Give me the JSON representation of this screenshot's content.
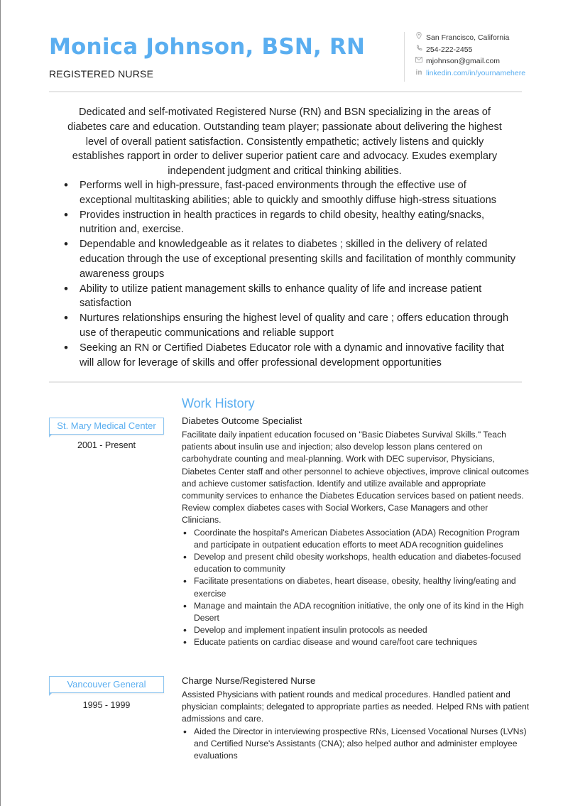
{
  "header": {
    "name": "Monica Johnson, BSN, RN",
    "title": "REGISTERED NURSE"
  },
  "contact": {
    "location": {
      "icon": "map-pin-icon",
      "text": "San Francisco, California"
    },
    "phone": {
      "icon": "phone-icon",
      "text": "254-222-2455"
    },
    "email": {
      "icon": "envelope-icon",
      "text": "mjohnson@gmail.com"
    },
    "linkedin": {
      "icon": "linkedin-icon",
      "glyph": "in",
      "text": "linkedin.com/in/yournamehere"
    }
  },
  "summary": {
    "paragraph": "Dedicated and self-motivated Registered Nurse (RN) and BSN  specializing in the areas of diabetes care and education. Outstanding team player; passionate about delivering the highest level of overall patient satisfaction. Consistently empathetic; actively listens and quickly establishes rapport in order to deliver superior patient care and advocacy. Exudes exemplary independent judgment and critical thinking abilities.",
    "bullets": [
      "Performs well in high-pressure, fast-paced environments through the effective use of exceptional multitasking abilities; able to quickly and smoothly diffuse high-stress situations",
      "Provides instruction in health practices in regards to child obesity, healthy eating/snacks, nutrition and, exercise.",
      "Dependable and knowledgeable as it relates to diabetes ; skilled in the delivery of related education through the use of exceptional presenting skills and facilitation of monthly community awareness groups",
      "Ability to utilize patient management skills to enhance quality of life  and increase patient satisfaction",
      "Nurtures relationships ensuring the highest level of quality and care ; offers education through use of therapeutic communications and reliable support",
      "Seeking an RN or Certified Diabetes Educator  role with a dynamic and innovative facility that will allow for leverage of skills and offer professional development opportunities"
    ]
  },
  "work_history": {
    "title": "Work History",
    "jobs": [
      {
        "company": "St. Mary Medical Center",
        "dates": "2001 - Present",
        "role": "Diabetes Outcome Specialist",
        "description": "Facilitate daily inpatient education focused on \"Basic Diabetes Survival Skills.\" Teach patients about insulin use and injection; also develop lesson plans centered on carbohydrate counting and meal-planning. Work with DEC supervisor, Physicians, Diabetes Center staff and other personnel to achieve objectives, improve clinical outcomes and achieve customer satisfaction. Identify and utilize available and appropriate community services to enhance the Diabetes Education services based on patient needs. Review complex diabetes cases with Social Workers, Case Managers and other Clinicians.",
        "bullets": [
          "Coordinate the hospital's American Diabetes Association (ADA) Recognition Program and participate in outpatient education efforts to meet ADA recognition guidelines",
          "Develop and present child obesity workshops, health education and diabetes-focused education to community",
          "Facilitate presentations on diabetes, heart disease, obesity, healthy living/eating and exercise",
          "Manage and maintain the ADA recognition initiative, the only one of its kind in the High Desert",
          "Develop and implement inpatient insulin protocols as needed",
          "Educate patients on cardiac disease and wound care/foot care techniques"
        ]
      },
      {
        "company": "Vancouver General",
        "dates": "1995 - 1999",
        "role": "Charge Nurse/Registered Nurse",
        "description": "Assisted Physicians with patient rounds and medical procedures. Handled patient and physician complaints; delegated to appropriate parties as needed. Helped RNs with patient admissions and care.",
        "bullets": [
          "Aided the Director in interviewing prospective RNs, Licensed Vocational Nurses (LVNs) and Certified Nurse's Assistants (CNA); also helped author and administer employee evaluations"
        ]
      }
    ]
  },
  "colors": {
    "accent": "#5aaef0",
    "text": "#222222",
    "divider": "#e6e6e6"
  }
}
